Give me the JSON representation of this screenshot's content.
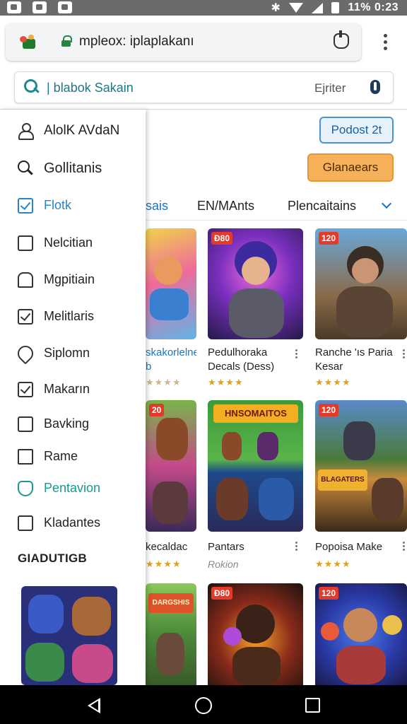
{
  "status_bar": {
    "clock": "11% 0:23",
    "icons": [
      "notification-icon",
      "notification-icon",
      "notification-icon",
      "bluetooth-icon",
      "wifi-icon",
      "signal-icon",
      "battery-icon"
    ]
  },
  "browser": {
    "url": "mpleox: iplaplakanı",
    "search_value": "| blabok Sakain",
    "filter_label": "Ejriter",
    "colors": {
      "accent": "#1e8a8a",
      "lock": "#1e8a3c"
    }
  },
  "drawer": {
    "items": [
      {
        "label": "AlolK AVdaN",
        "icon": "person-icon"
      },
      {
        "label": "Gollitanis",
        "icon": "search-icon"
      },
      {
        "label": "Flotk",
        "icon": "checkbox-icon"
      },
      {
        "label": "Nelcitian",
        "icon": "clipboard-icon"
      },
      {
        "label": "Mgpitiain",
        "icon": "store-icon"
      },
      {
        "label": "Melitlaris",
        "icon": "checkbox-icon"
      },
      {
        "label": "Siplomn",
        "icon": "leaf-icon"
      },
      {
        "label": "Makarın",
        "icon": "checkbox-icon"
      },
      {
        "label": "Bavking",
        "icon": "edit-icon"
      },
      {
        "label": "Rame",
        "icon": "folder-icon"
      },
      {
        "label": "Pentavion",
        "icon": "heart-icon"
      },
      {
        "label": "Kladantes",
        "icon": "document-icon"
      }
    ],
    "section_title": "GIADUTIGB"
  },
  "main": {
    "button_primary": "Podost 2t",
    "button_secondary": "Glanaears",
    "tabs": [
      "sais",
      "EN/MAnts",
      "Plencaitains"
    ],
    "cards": [
      {
        "title": "skakorlelne\nb",
        "badge": "",
        "stars": "★★★★",
        "sub": ""
      },
      {
        "title": "Pedulhoraka\nDecals (Dess)",
        "badge": "Đ80",
        "stars": "★★★★",
        "sub": ""
      },
      {
        "title": "Ranche 'ıs Paria\nKesar",
        "badge": "120",
        "stars": "★★★★",
        "sub": ""
      },
      {
        "title": "kecaldac",
        "badge": "20",
        "stars": "★★★★",
        "sub": ""
      },
      {
        "title": "Pantars",
        "badge": "",
        "stars": "",
        "sub": "Rokion"
      },
      {
        "title": "Popoisa Make",
        "badge": "120",
        "stars": "★★★★",
        "sub": ""
      },
      {
        "title": "",
        "badge": "",
        "stars": "",
        "sub": ""
      },
      {
        "title": "",
        "badge": "Đ80",
        "stars": "",
        "sub": ""
      },
      {
        "title": "",
        "badge": "120",
        "stars": "",
        "sub": ""
      }
    ],
    "thumb_texts": [
      "HNSOMAITOS",
      "BLAGATERS",
      "DARGSHIS"
    ]
  }
}
